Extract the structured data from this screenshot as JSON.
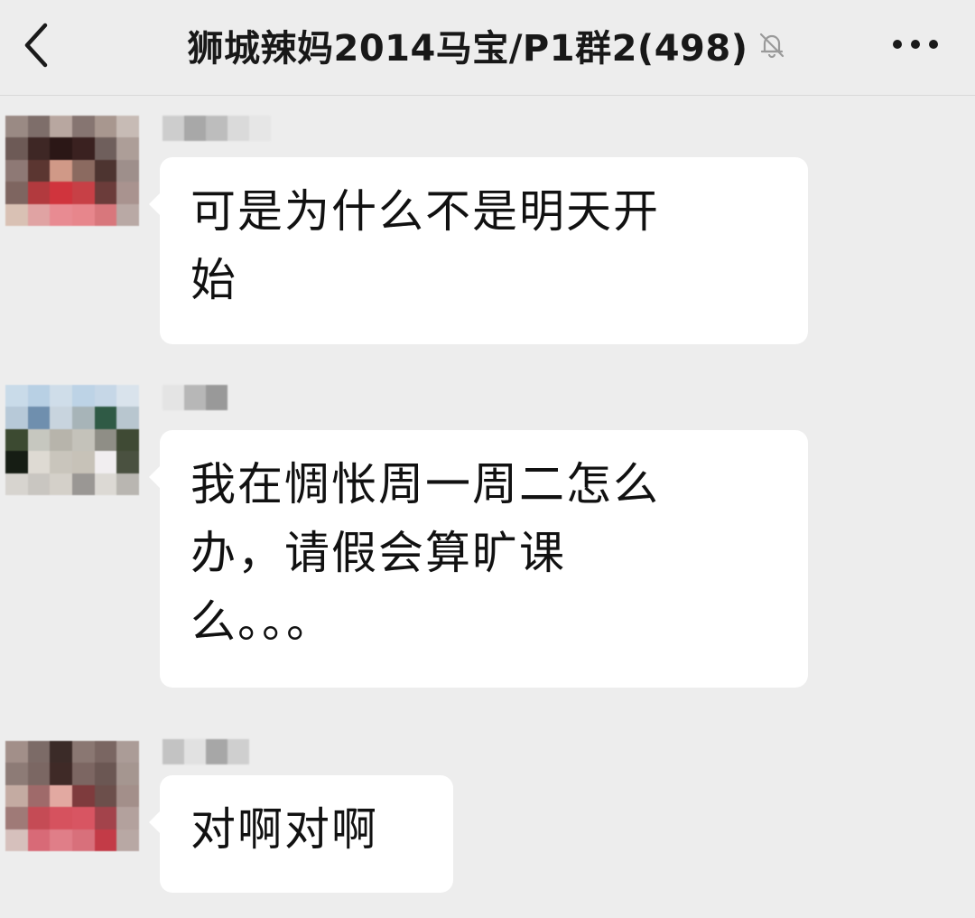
{
  "header": {
    "title": "狮城辣妈2014马宝/P1群2(498)",
    "back_icon": "chevron-left-icon",
    "mute_icon": "bell-off-icon",
    "more_icon": "more-dots-icon"
  },
  "messages": [
    {
      "text": "可是为什么不是明天开\n始"
    },
    {
      "text": "我在惆怅周一周二怎么\n办，请假会算旷课\n么。。。"
    },
    {
      "text": "对啊对啊"
    }
  ],
  "colors": {
    "background": "#ededed",
    "bubble": "#ffffff",
    "text": "#111111"
  }
}
